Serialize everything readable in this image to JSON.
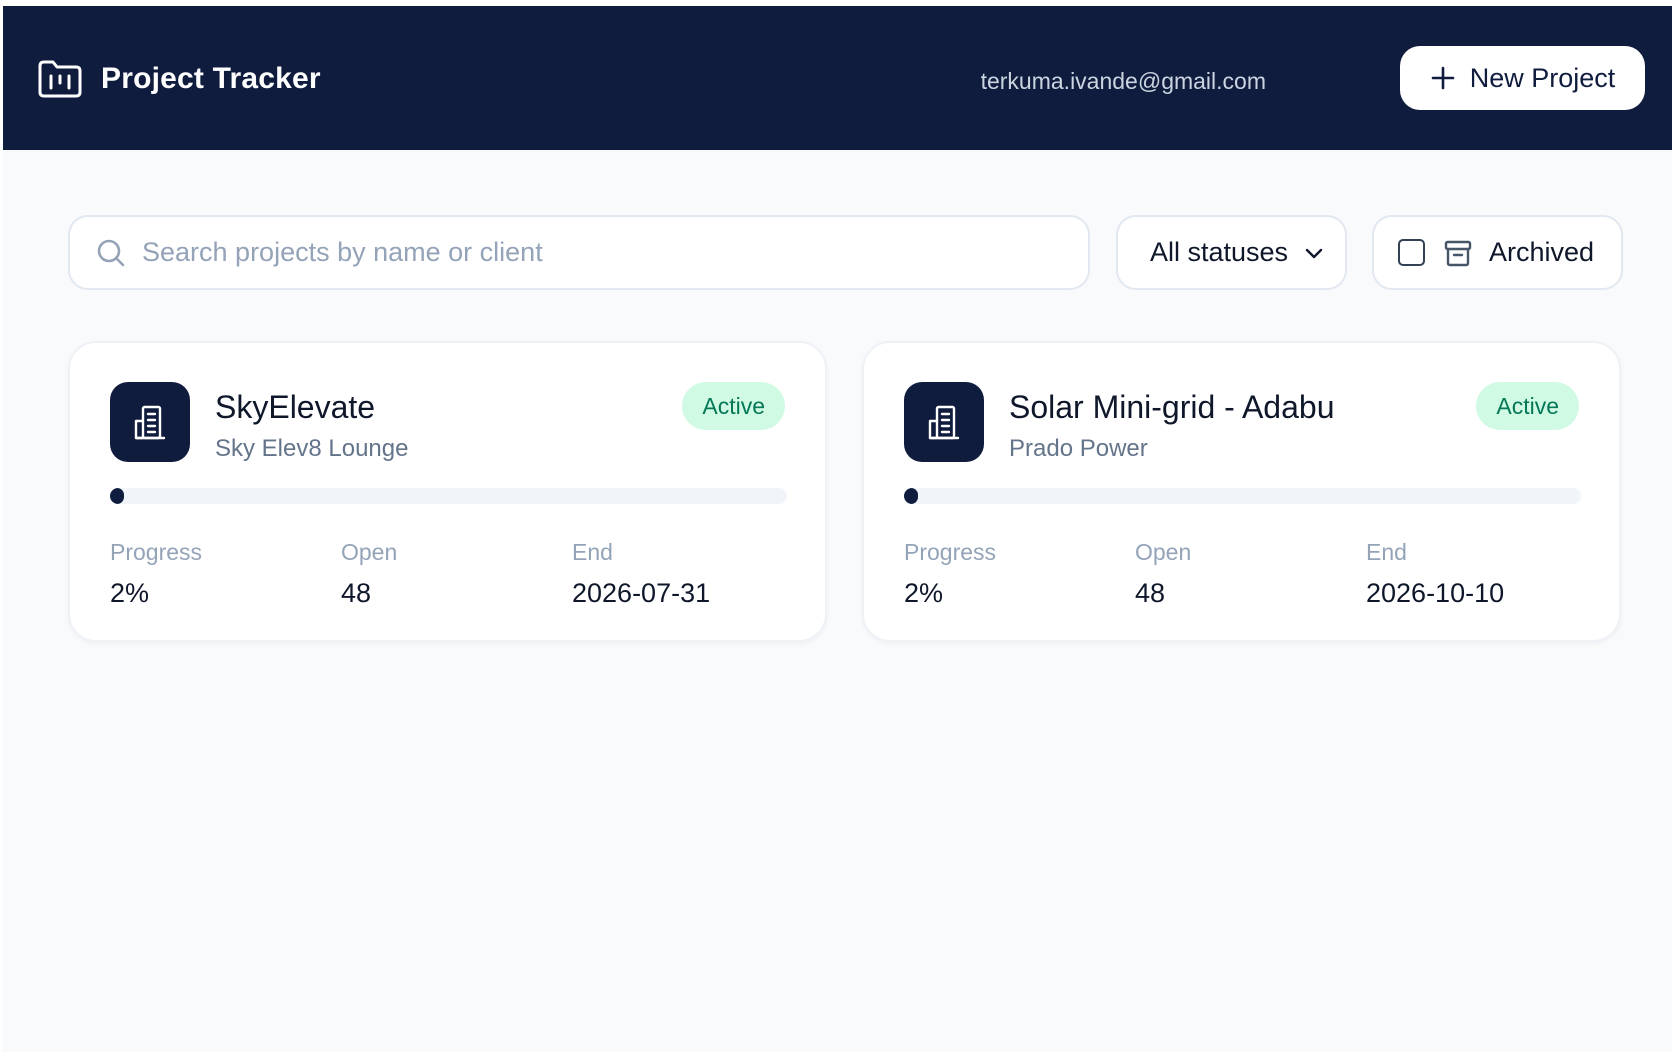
{
  "header": {
    "title": "Project Tracker",
    "user_email": "terkuma.ivande@gmail.com",
    "new_project_label": "New Project"
  },
  "filters": {
    "search_placeholder": "Search projects by name or client",
    "search_value": "",
    "status_selected": "All statuses",
    "archived_label": "Archived",
    "archived_checked": false
  },
  "colors": {
    "header_bg": "#101c3e",
    "badge_bg": "#d1fae5",
    "badge_text": "#047857"
  },
  "projects": [
    {
      "name": "SkyElevate",
      "client": "Sky Elev8 Lounge",
      "status": "Active",
      "progress_label": "Progress",
      "progress": "2%",
      "progress_fraction": 0.02,
      "open_label": "Open",
      "open": "48",
      "end_label": "End",
      "end": "2026-07-31",
      "icon": "building-icon"
    },
    {
      "name": "Solar Mini-grid - Adabu",
      "client": "Prado Power",
      "status": "Active",
      "progress_label": "Progress",
      "progress": "2%",
      "progress_fraction": 0.02,
      "open_label": "Open",
      "open": "48",
      "end_label": "End",
      "end": "2026-10-10",
      "icon": "building-icon"
    }
  ]
}
